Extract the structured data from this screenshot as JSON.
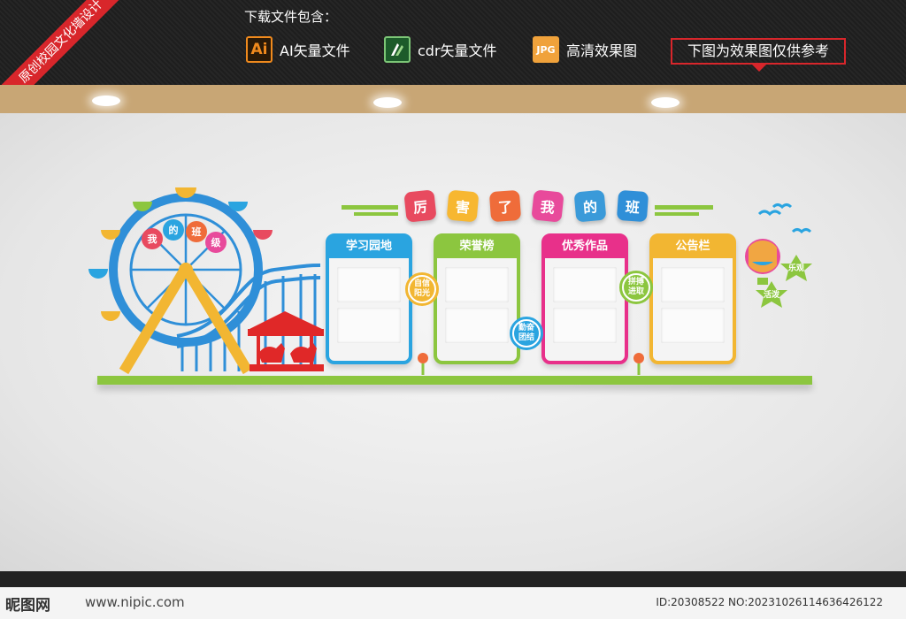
{
  "ribbon": "原创校园文化墙设计",
  "download_title": "下载文件包含：",
  "file_types": [
    {
      "icon": "Ai",
      "label": "AI矢量文件"
    },
    {
      "icon": "",
      "label": "cdr矢量文件"
    },
    {
      "icon": "JPG",
      "label": "高清效果图"
    }
  ],
  "note": "下图为效果图仅供参考",
  "headline_chars": [
    "厉",
    "害",
    "了",
    "我",
    "的",
    "班"
  ],
  "headline_colors": [
    "#e84a5f",
    "#f7b731",
    "#ef6c3a",
    "#e84a9b",
    "#3a9ad9",
    "#2f8fd8"
  ],
  "wheel_chars": [
    "我",
    "的",
    "班",
    "级"
  ],
  "boards": [
    {
      "title": "学习园地",
      "color": "#2aa4e0"
    },
    {
      "title": "荣誉榜",
      "color": "#8cc63f"
    },
    {
      "title": "优秀作品",
      "color": "#e8308a"
    },
    {
      "title": "公告栏",
      "color": "#f2b632"
    }
  ],
  "badges": [
    {
      "text": "自信 阳光",
      "color": "#f2b632"
    },
    {
      "text": "勤奋 团结",
      "color": "#2aa4e0"
    },
    {
      "text": "拼搏 进取",
      "color": "#8cc63f"
    }
  ],
  "stars": [
    "乐观",
    "活泼"
  ],
  "footer": {
    "brand": "昵图网",
    "url": "www.nipic.com",
    "id": "ID:20308522 NO:20231026114636426122"
  }
}
